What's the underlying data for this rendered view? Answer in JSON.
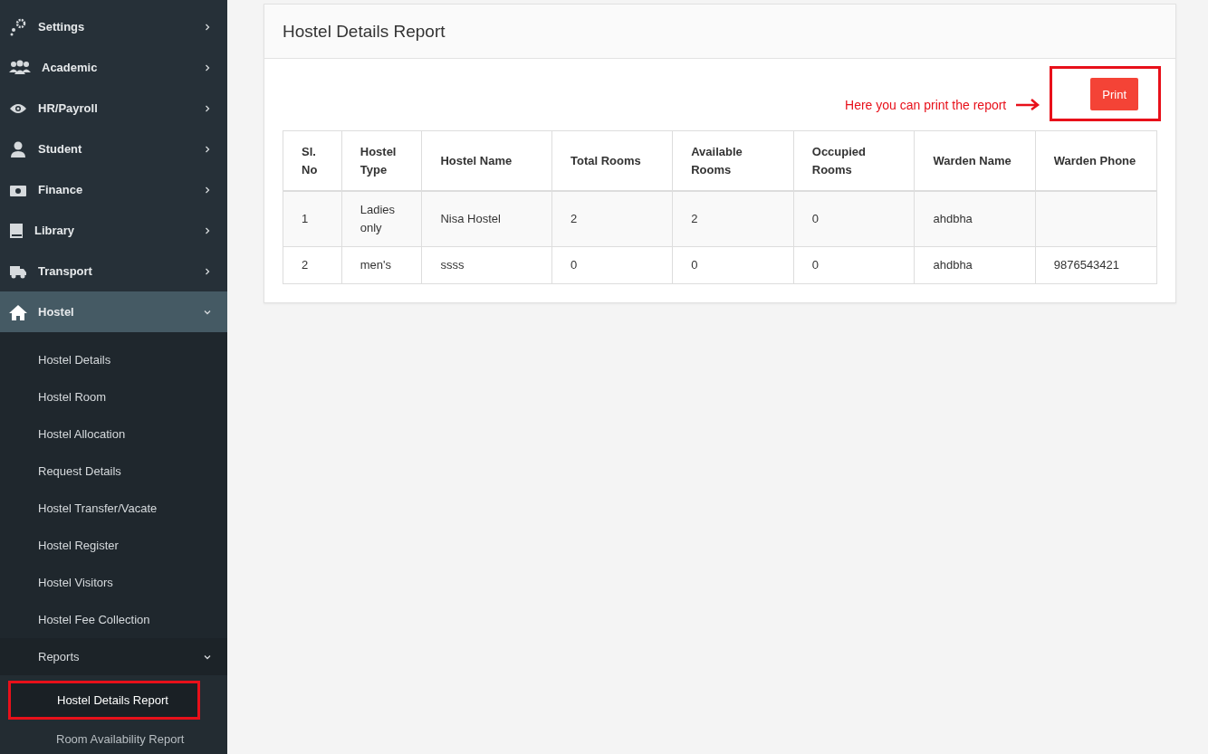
{
  "sidebar": {
    "items": [
      {
        "label": "Settings",
        "expanded": false
      },
      {
        "label": "Academic",
        "expanded": false
      },
      {
        "label": "HR/Payroll",
        "expanded": false
      },
      {
        "label": "Student",
        "expanded": false
      },
      {
        "label": "Finance",
        "expanded": false
      },
      {
        "label": "Library",
        "expanded": false
      },
      {
        "label": "Transport",
        "expanded": false
      },
      {
        "label": "Hostel",
        "expanded": true,
        "children": [
          {
            "label": "Hostel Details"
          },
          {
            "label": "Hostel Room"
          },
          {
            "label": "Hostel Allocation"
          },
          {
            "label": "Request Details"
          },
          {
            "label": "Hostel Transfer/Vacate"
          },
          {
            "label": "Hostel Register"
          },
          {
            "label": "Hostel Visitors"
          },
          {
            "label": "Hostel Fee Collection"
          },
          {
            "label": "Reports",
            "expanded": true,
            "children": [
              {
                "label": "Hostel Details Report",
                "selected": true,
                "highlighted": true
              },
              {
                "label": "Room Availability Report",
                "selected": false,
                "highlighted": false
              }
            ]
          }
        ]
      }
    ]
  },
  "panel": {
    "title": "Hostel Details Report",
    "annotation": {
      "text": "Here you can print the report"
    },
    "print_button": {
      "label": "Print",
      "highlighted": true
    },
    "table": {
      "columns": [
        "Sl. No",
        "Hostel Type",
        "Hostel Name",
        "Total Rooms",
        "Available Rooms",
        "Occupied Rooms",
        "Warden Name",
        "Warden Phone"
      ],
      "rows": [
        {
          "cells": [
            "1",
            "Ladies only",
            "Nisa Hostel",
            "2",
            "2",
            "0",
            "ahdbha",
            null
          ]
        },
        {
          "cells": [
            "2",
            "men's",
            "ssss",
            "0",
            "0",
            "0",
            "ahdbha",
            "9876543421"
          ]
        }
      ]
    }
  }
}
